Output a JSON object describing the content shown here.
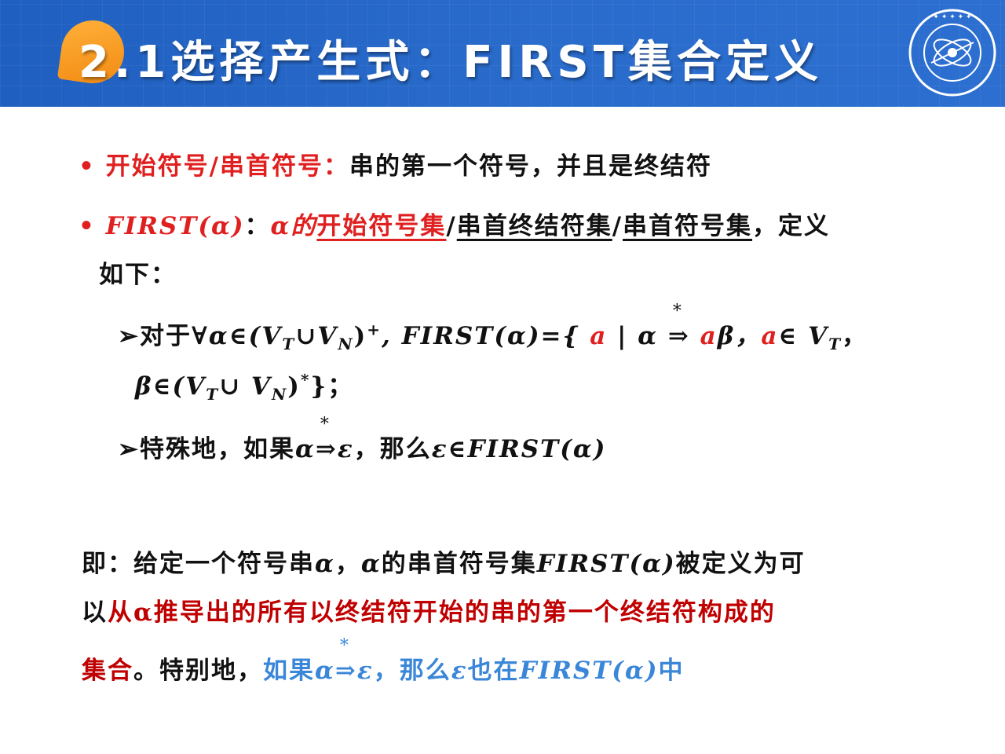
{
  "header": {
    "title": "2.1选择产生式：FIRST集合定义",
    "logo_text": "GUILIN UNIVERSITY OF ELECTRONIC TECHNOLOGY"
  },
  "bullet1": {
    "bullet": "•",
    "term": "开始符号/串首符号：",
    "definition": "串的第一个符号，并且是终结符"
  },
  "bullet2": {
    "bullet": "•",
    "func": "FIRST(α)",
    "colon": "：",
    "alpha_de": "α的",
    "name1": "开始符号集",
    "sep1": "/",
    "name2": "串首终结符集",
    "sep2": "/",
    "name3": "串首符号集",
    "tail": "，定义",
    "cont": "如下："
  },
  "rule1": {
    "marker": "➢",
    "lead": "对于",
    "p1": "∀α∈(V",
    "sub_t1": "T",
    "p2": "∪V",
    "sub_n1": "N",
    "p3": ")",
    "sup_plus": "+",
    "p4": ", FIRST(α)={ ",
    "a1": "a",
    "p5": " | α ",
    "star1": "*",
    "arrow1": "⇒",
    "a2": " a",
    "p6": "β，",
    "a3": "a",
    "p7": "∈ V",
    "sub_t2": "T",
    "p8": "，",
    "cont_p1": "β∈(V",
    "sub_t3": "T",
    "cont_p2": "∪ V",
    "sub_n2": "N",
    "cont_p3": ")",
    "sup_star": "*",
    "cont_p4": "}；"
  },
  "rule2": {
    "marker": "➢",
    "lead": "特殊地，如果",
    "alpha": "α",
    "star": "*",
    "arrow": "⇒",
    "eps": "ε",
    "mid": "，那么",
    "tail": "ε∈FIRST(α)"
  },
  "summary": {
    "l1_a": "即：给定一个符号串",
    "l1_alpha": "α",
    "l1_b": "，",
    "l1_alpha2": "α",
    "l1_c": "的串首符号集",
    "l1_func": "FIRST(α)",
    "l1_d": "被定义为可",
    "l2_a": "以",
    "l2_red": "从α推导出的所有以终结符开始的串的第一个终结符构成的",
    "l3_red": "集合",
    "l3_b": "。特别地，",
    "l3_blue_a": "如果",
    "l3_alpha": "α",
    "l3_star": "*",
    "l3_arrow": "⇒",
    "l3_eps": "ε",
    "l3_blue_b": "，那么",
    "l3_eps2": "ε",
    "l3_blue_c": "也在",
    "l3_func": "FIRST(α)",
    "l3_blue_d": "中"
  },
  "colors": {
    "header_blue": "#2a6ccc",
    "badge_orange": "#f59a1e",
    "red": "#e02020",
    "dark_red": "#c00000",
    "blue": "#3a86d8"
  }
}
